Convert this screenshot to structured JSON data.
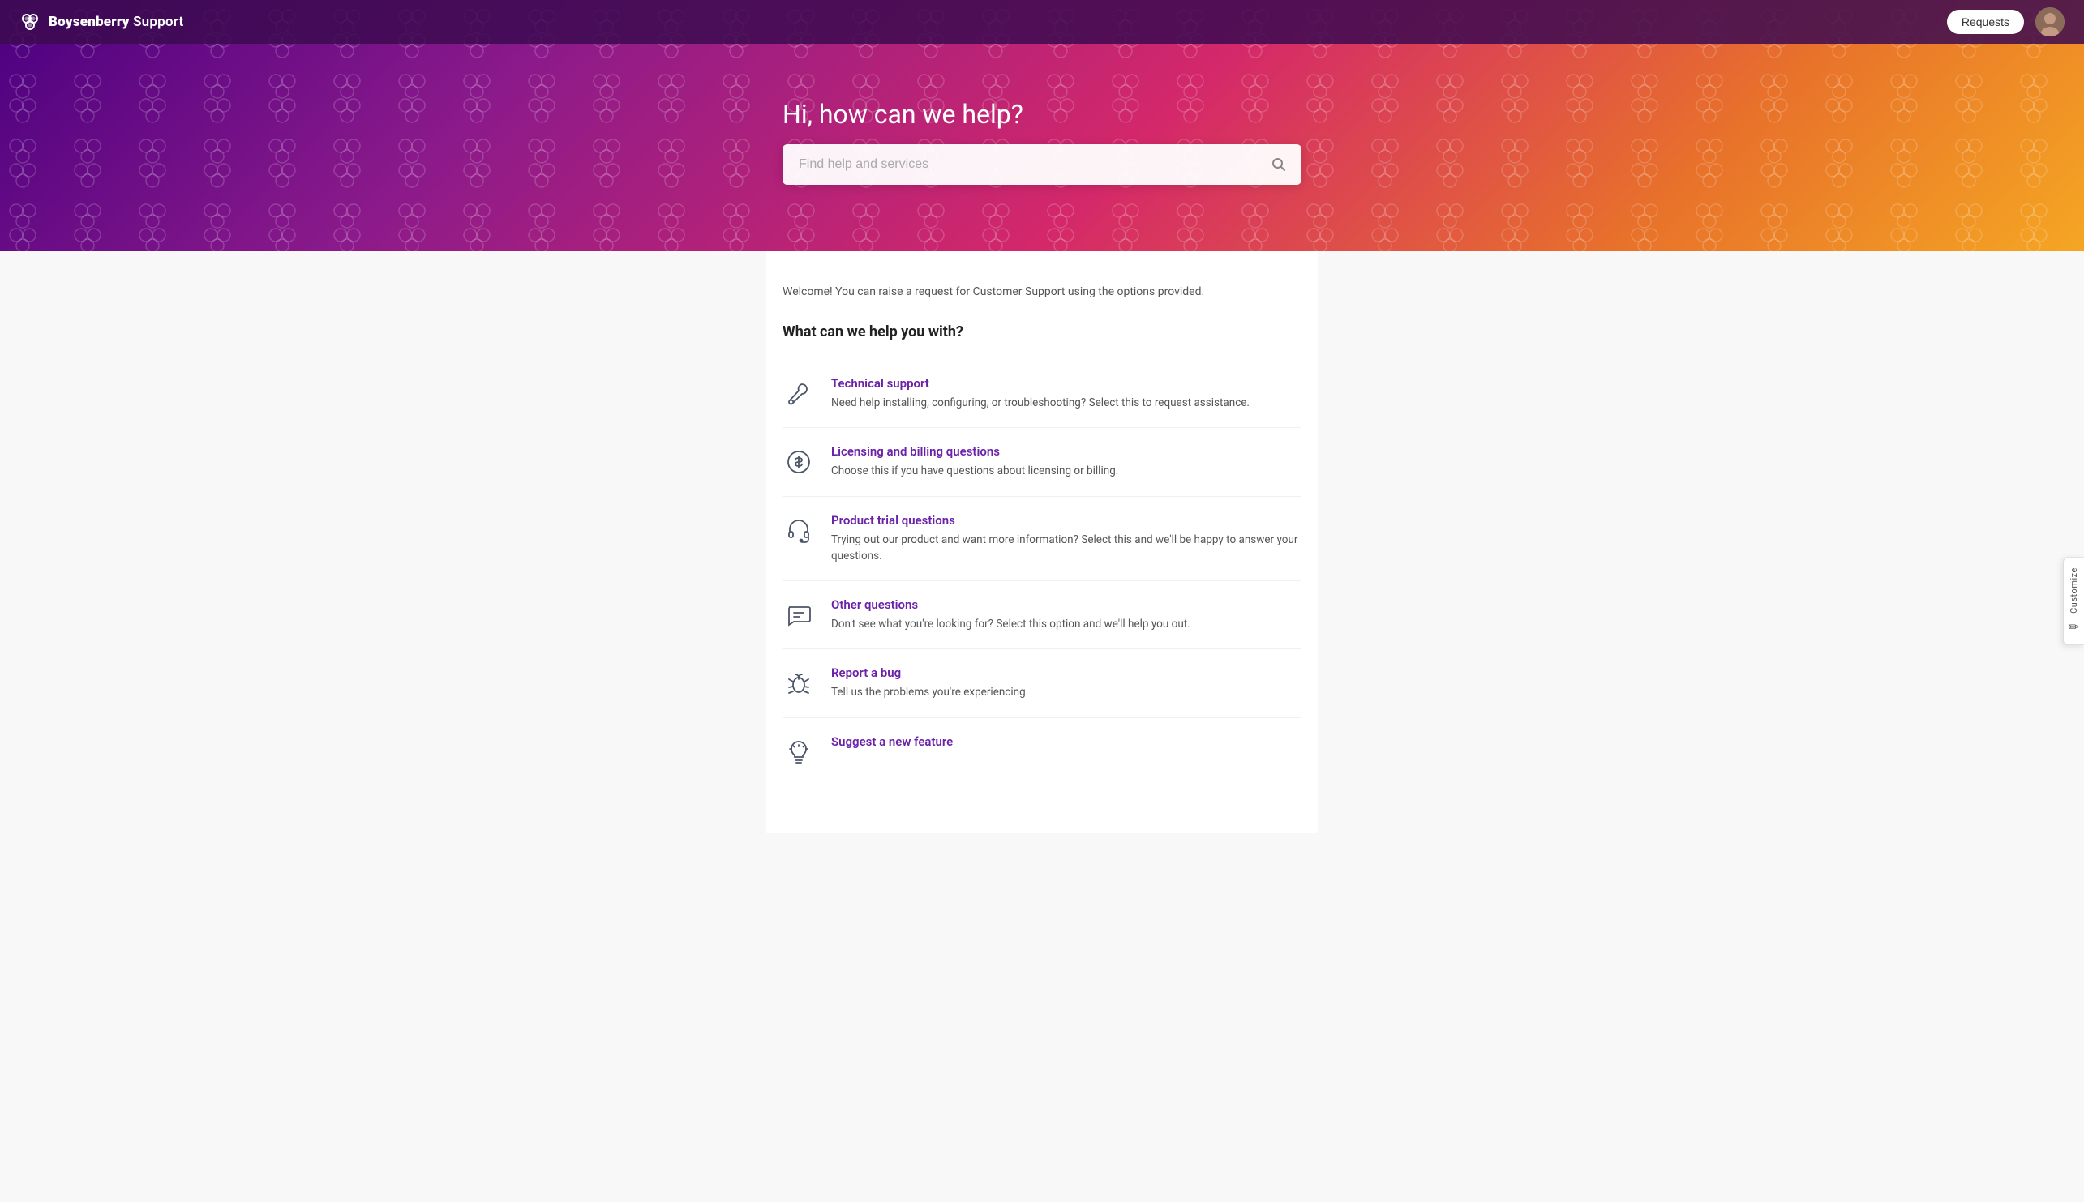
{
  "navbar": {
    "brand": "Boysenberry Support",
    "brand_bold": "Boysenberry",
    "brand_normal": " Support",
    "requests_label": "Requests"
  },
  "hero": {
    "title": "Hi, how can we help?",
    "search_placeholder": "Find help and services"
  },
  "customize": {
    "label": "Customize",
    "icon": "✏"
  },
  "main": {
    "welcome_text": "Welcome! You can raise a request for Customer Support using the options provided.",
    "section_title": "What can we help you with?",
    "services": [
      {
        "id": "technical-support",
        "title": "Technical support",
        "description": "Need help installing, configuring, or troubleshooting? Select this to request assistance.",
        "icon": "wrench-screwdriver"
      },
      {
        "id": "licensing-billing",
        "title": "Licensing and billing questions",
        "description": "Choose this if you have questions about licensing or billing.",
        "icon": "dollar-circle"
      },
      {
        "id": "product-trial",
        "title": "Product trial questions",
        "description": "Trying out our product and want more information? Select this and we'll be happy to answer your questions.",
        "icon": "headset"
      },
      {
        "id": "other-questions",
        "title": "Other questions",
        "description": "Don't see what you're looking for? Select this option and we'll help you out.",
        "icon": "chat"
      },
      {
        "id": "report-bug",
        "title": "Report a bug",
        "description": "Tell us the problems you're experiencing.",
        "icon": "bug"
      },
      {
        "id": "suggest-feature",
        "title": "Suggest a new feature",
        "description": "",
        "icon": "lightbulb"
      }
    ]
  }
}
